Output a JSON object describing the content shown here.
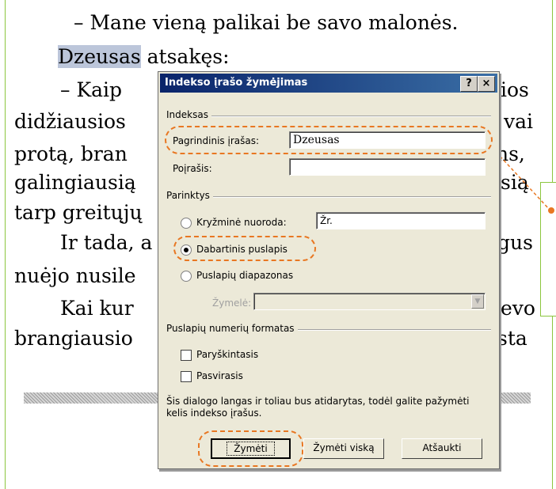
{
  "document": {
    "lines": [
      "– Mane vieną palikai be savo malonės.",
      "Dzeusas",
      "atsakęs:",
      "– Kaip",
      "ios",
      "didžiausios",
      "vai",
      "protą, bran",
      "ns,",
      "galingiausią",
      "sią",
      "tarp greitųjų",
      "Ir tada, a",
      "gus",
      "nuėjo nusile",
      "Kai kur",
      "evo",
      "brangiausio",
      "sta"
    ]
  },
  "dialog": {
    "title": "Indekso įrašo žymėjimas",
    "help_button": "?",
    "close_button": "×",
    "index_group": "Indeksas",
    "main_entry_label": "Pagrindinis įrašas:",
    "main_entry_value": "Dzeusas",
    "subentry_label": "Poįrašis:",
    "subentry_value": "",
    "options_group": "Parinktys",
    "cross_ref_label": "Kryžminė nuoroda:",
    "cross_ref_value": "Žr.",
    "current_page_label": "Dabartinis puslapis",
    "page_range_label": "Puslapių diapazonas",
    "bookmark_label": "Žymelė:",
    "page_format_group": "Puslapių numerių formatas",
    "bold_label": "Paryškintasis",
    "italic_label": "Pasvirasis",
    "note": "Šis dialogo langas ir toliau bus atidarytas, todėl galite pažymėti kelis indekso įrašus.",
    "mark_button": "Žymėti",
    "mark_all_button": "Žymėti viską",
    "cancel_button": "Atšaukti",
    "selected_option": "Dabartinis puslapis"
  },
  "colors": {
    "highlight": "#e87722",
    "border_green": "#8cc63f",
    "titlebar": "#0a246a"
  }
}
